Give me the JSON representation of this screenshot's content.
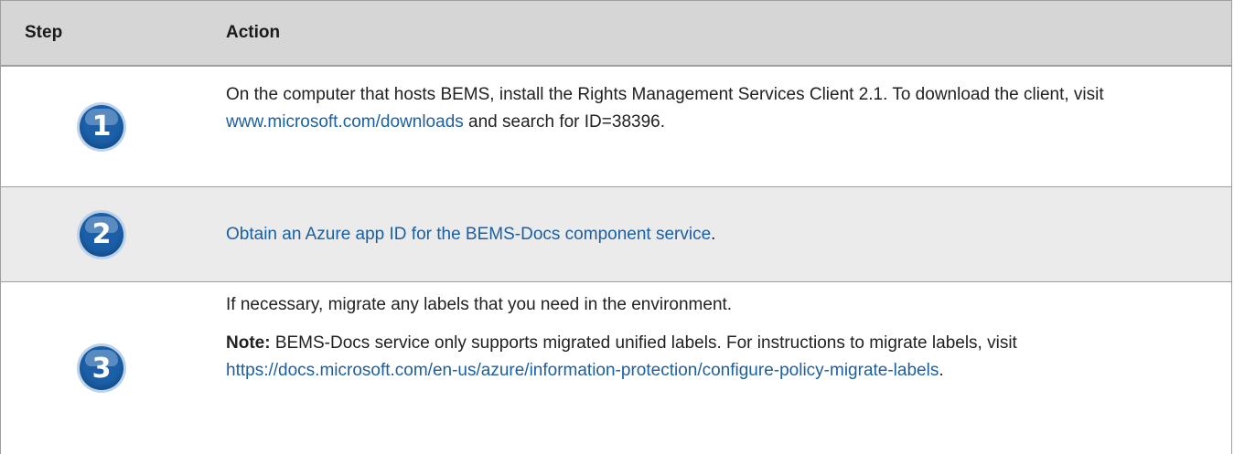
{
  "table": {
    "headers": {
      "step": "Step",
      "action": "Action"
    },
    "rows": [
      {
        "number": "1",
        "text_before": "On the computer that hosts BEMS, install the Rights Management Services Client 2.1. To download the client, visit ",
        "link": "www.microsoft.com/downloads",
        "text_after": " and search for ID=38396."
      },
      {
        "number": "2",
        "link": "Obtain an Azure app ID for the BEMS-Docs component service",
        "text_after": "."
      },
      {
        "number": "3",
        "text": "If necessary, migrate any labels that you need in the environment.",
        "note_label": "Note:",
        "note_text": "  BEMS-Docs service only supports migrated unified labels. For instructions to migrate labels, visit ",
        "note_link": "https://docs.microsoft.com/en-us/azure/information-protection/configure-policy-migrate-labels",
        "note_after": "."
      }
    ]
  },
  "colors": {
    "header_bg": "#d6d6d6",
    "shaded_row_bg": "#ebebeb",
    "link": "#1b5fa3",
    "badge": "#1a5fa8"
  }
}
